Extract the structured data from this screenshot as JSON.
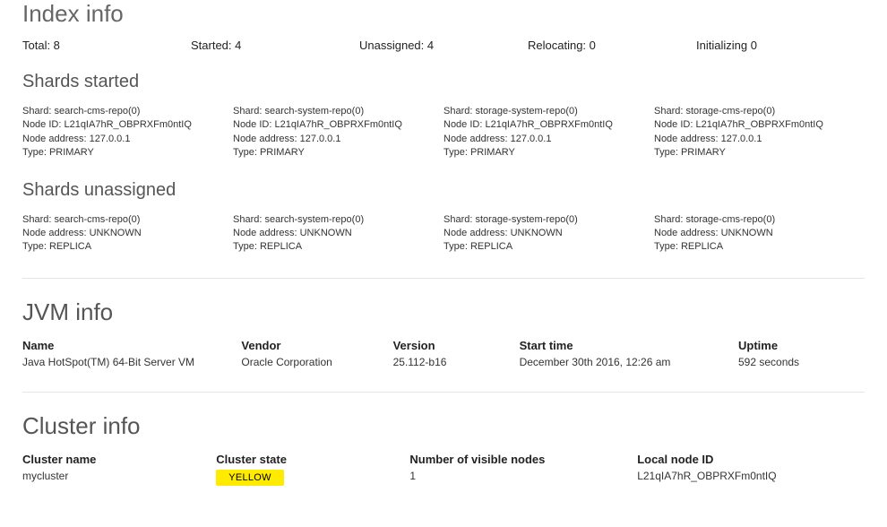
{
  "index_info": {
    "title": "Index info",
    "stats": {
      "total_label": "Total: 8",
      "started_label": "Started: 4",
      "unassigned_label": "Unassigned: 4",
      "relocating_label": "Relocating: 0",
      "initializing_label": "Initializing 0"
    }
  },
  "shards_started": {
    "title": "Shards started",
    "items": [
      {
        "shard": "Shard: search-cms-repo(0)",
        "node_id": "Node ID: L21qIA7hR_OBPRXFm0ntIQ",
        "node_address": "Node address: 127.0.0.1",
        "type": "Type: PRIMARY"
      },
      {
        "shard": "Shard: search-system-repo(0)",
        "node_id": "Node ID: L21qIA7hR_OBPRXFm0ntIQ",
        "node_address": "Node address: 127.0.0.1",
        "type": "Type: PRIMARY"
      },
      {
        "shard": "Shard: storage-system-repo(0)",
        "node_id": "Node ID: L21qIA7hR_OBPRXFm0ntIQ",
        "node_address": "Node address: 127.0.0.1",
        "type": "Type: PRIMARY"
      },
      {
        "shard": "Shard: storage-cms-repo(0)",
        "node_id": "Node ID: L21qIA7hR_OBPRXFm0ntIQ",
        "node_address": "Node address: 127.0.0.1",
        "type": "Type: PRIMARY"
      }
    ]
  },
  "shards_unassigned": {
    "title": "Shards unassigned",
    "items": [
      {
        "shard": "Shard: search-cms-repo(0)",
        "node_address": "Node address: UNKNOWN",
        "type": "Type: REPLICA"
      },
      {
        "shard": "Shard: search-system-repo(0)",
        "node_address": "Node address: UNKNOWN",
        "type": "Type: REPLICA"
      },
      {
        "shard": "Shard: storage-system-repo(0)",
        "node_address": "Node address: UNKNOWN",
        "type": "Type: REPLICA"
      },
      {
        "shard": "Shard: storage-cms-repo(0)",
        "node_address": "Node address: UNKNOWN",
        "type": "Type: REPLICA"
      }
    ]
  },
  "jvm_info": {
    "title": "JVM info",
    "fields": {
      "name_label": "Name",
      "name_value": "Java HotSpot(TM) 64-Bit Server VM",
      "vendor_label": "Vendor",
      "vendor_value": "Oracle Corporation",
      "version_label": "Version",
      "version_value": "25.112-b16",
      "start_label": "Start time",
      "start_value": "December 30th 2016, 12:26 am",
      "uptime_label": "Uptime",
      "uptime_value": "592 seconds"
    }
  },
  "cluster_info": {
    "title": "Cluster info",
    "fields": {
      "name_label": "Cluster name",
      "name_value": "mycluster",
      "state_label": "Cluster state",
      "state_value": "YELLOW",
      "nodes_label": "Number of visible nodes",
      "nodes_value": "1",
      "local_label": "Local node ID",
      "local_value": "L21qIA7hR_OBPRXFm0ntIQ"
    }
  }
}
